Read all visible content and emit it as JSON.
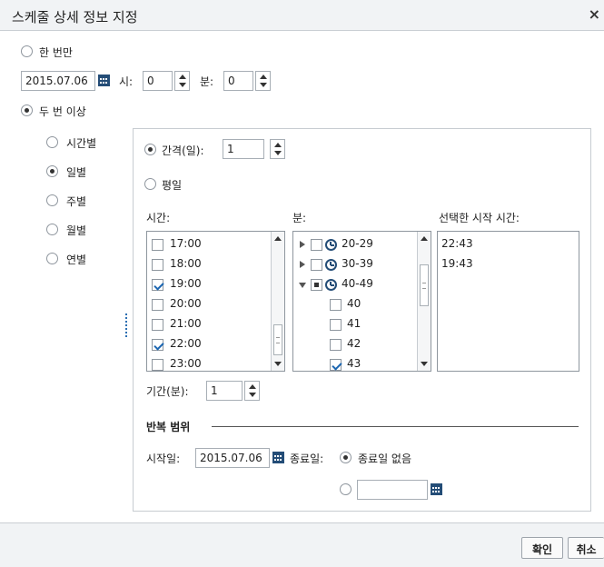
{
  "dialog": {
    "title": "스케줄 상세 정보 지정",
    "close": "×"
  },
  "once": {
    "label": "한 번만",
    "date": "2015.07.06",
    "hour_label": "시:",
    "hour": "0",
    "minute_label": "분:",
    "minute": "0"
  },
  "multiple": {
    "label": "두 번 이상"
  },
  "frequency": [
    {
      "label": "시간별",
      "selected": false
    },
    {
      "label": "일별",
      "selected": true
    },
    {
      "label": "주별",
      "selected": false
    },
    {
      "label": "월별",
      "selected": false
    },
    {
      "label": "연별",
      "selected": false
    }
  ],
  "daily": {
    "interval_label": "간격(일):",
    "interval": "1",
    "weekday_label": "평일"
  },
  "times": {
    "hours_label": "시간:",
    "minutes_label": "분:",
    "selected_label": "선택한 시작 시간:",
    "hours": [
      {
        "label": "17:00",
        "checked": false
      },
      {
        "label": "18:00",
        "checked": false
      },
      {
        "label": "19:00",
        "checked": true
      },
      {
        "label": "20:00",
        "checked": false
      },
      {
        "label": "21:00",
        "checked": false
      },
      {
        "label": "22:00",
        "checked": true
      },
      {
        "label": "23:00",
        "checked": false
      }
    ],
    "minute_groups": [
      {
        "label": "20-29",
        "state": "collapsed"
      },
      {
        "label": "30-39",
        "state": "collapsed"
      },
      {
        "label": "40-49",
        "state": "expanded"
      }
    ],
    "minutes": [
      {
        "label": "40",
        "checked": false
      },
      {
        "label": "41",
        "checked": false
      },
      {
        "label": "42",
        "checked": false
      },
      {
        "label": "43",
        "checked": true
      }
    ],
    "selected_times": [
      "22:43",
      "19:43"
    ],
    "duration_label": "기간(분):",
    "duration": "1"
  },
  "range": {
    "heading": "반복 범위",
    "start_label": "시작일:",
    "start_date": "2015.07.06",
    "end_label": "종료일:",
    "no_end_label": "종료일 없음",
    "end_date": ""
  },
  "buttons": {
    "ok": "확인",
    "cancel": "취소"
  }
}
